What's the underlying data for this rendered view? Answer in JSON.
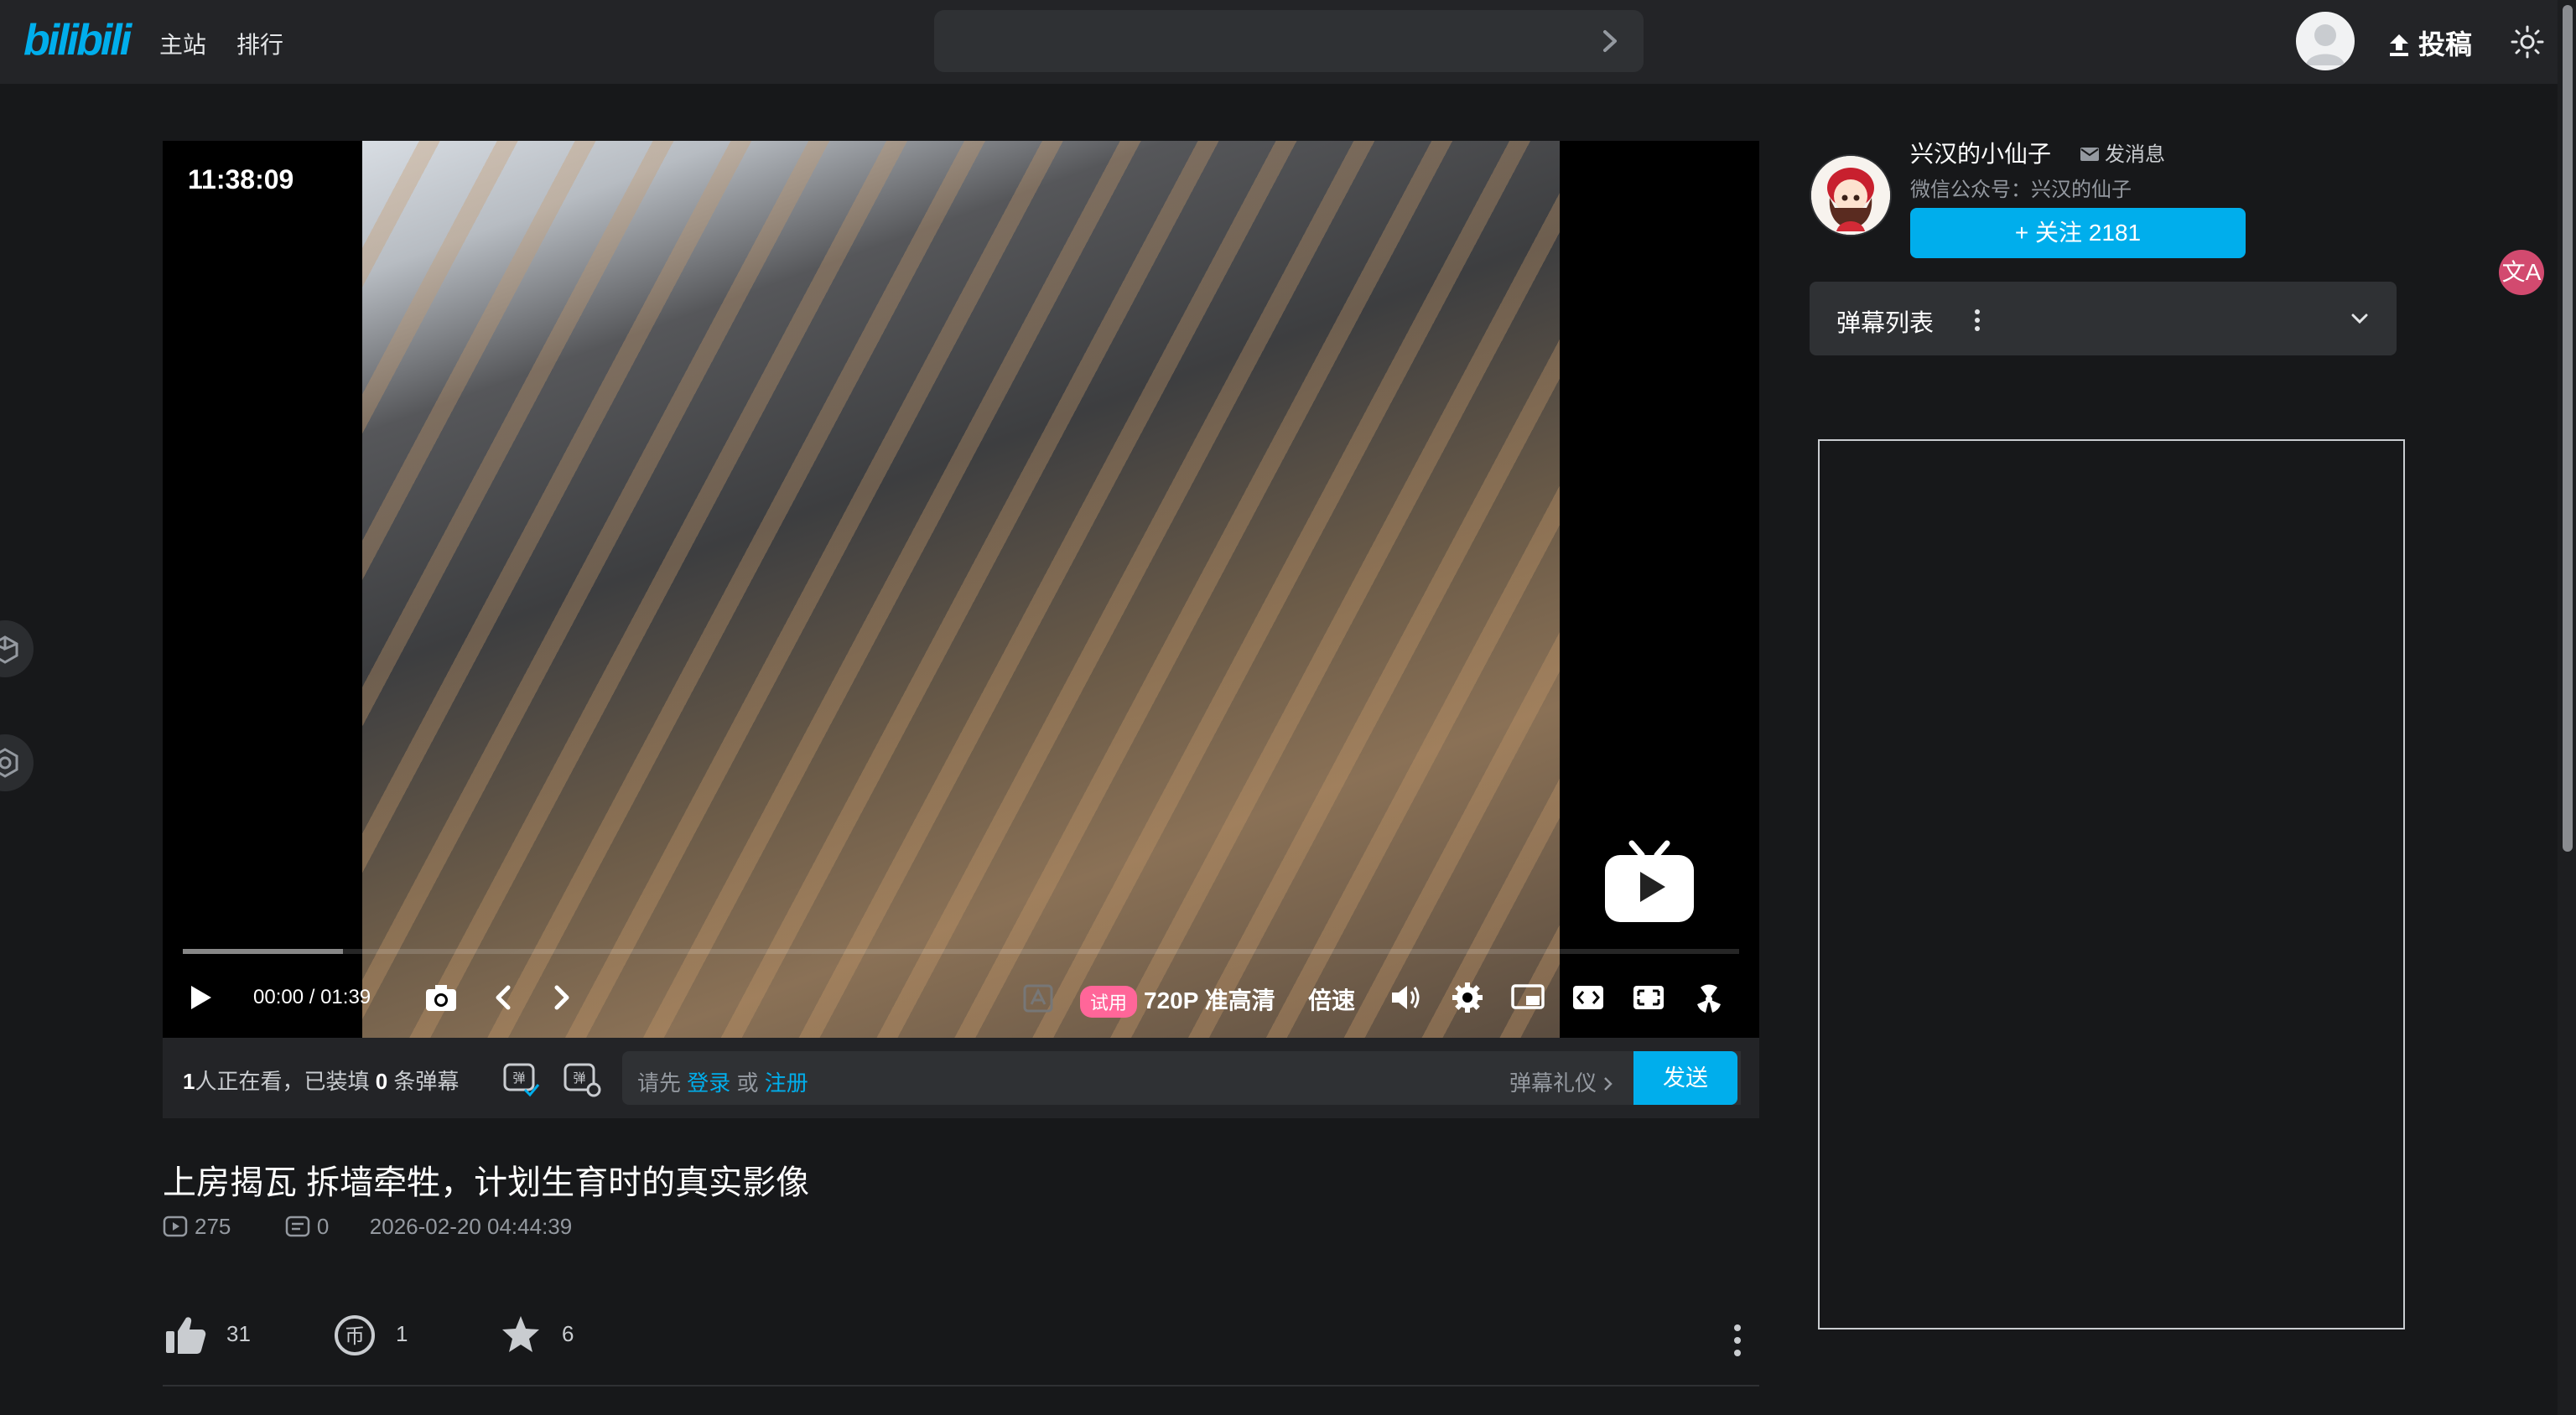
{
  "header": {
    "logo_text": "bilibili",
    "nav": [
      "主站",
      "排行"
    ],
    "upload_label": "投稿"
  },
  "player": {
    "clock": "11:38:09",
    "time_current": "00:00",
    "time_separator": "/",
    "time_total": "01:39",
    "progress_buffered": 0.103,
    "trial_badge": "试用",
    "quality": "720P 准高清",
    "speed": "倍速"
  },
  "danmaku_bar": {
    "viewers_count": "1",
    "viewers_prefix": "人正在看，已装填 ",
    "danmaku_count": "0",
    "danmaku_suffix": " 条弹幕",
    "placeholder_prefix": "请先 ",
    "login": "登录",
    "or": " 或 ",
    "register": "注册",
    "etiquette": "弹幕礼仪",
    "send": "发送"
  },
  "video": {
    "title": "上房揭瓦 拆墙牵牲，计划生育时的真实影像",
    "plays": "275",
    "danmaku": "0",
    "date": "2026-02-20 04:44:39",
    "likes": "31",
    "coins": "1",
    "favorites": "6"
  },
  "uploader": {
    "name": "兴汉的小仙子",
    "message": "发消息",
    "desc": "微信公众号：兴汉的仙子",
    "follow": "+ 关注 2181"
  },
  "sidebar": {
    "danmaku_list": "弹幕列表"
  },
  "translate_badge": "文A",
  "colors": {
    "accent": "#00aeec",
    "background": "#17181a",
    "badge_pink": "#ff6699"
  }
}
